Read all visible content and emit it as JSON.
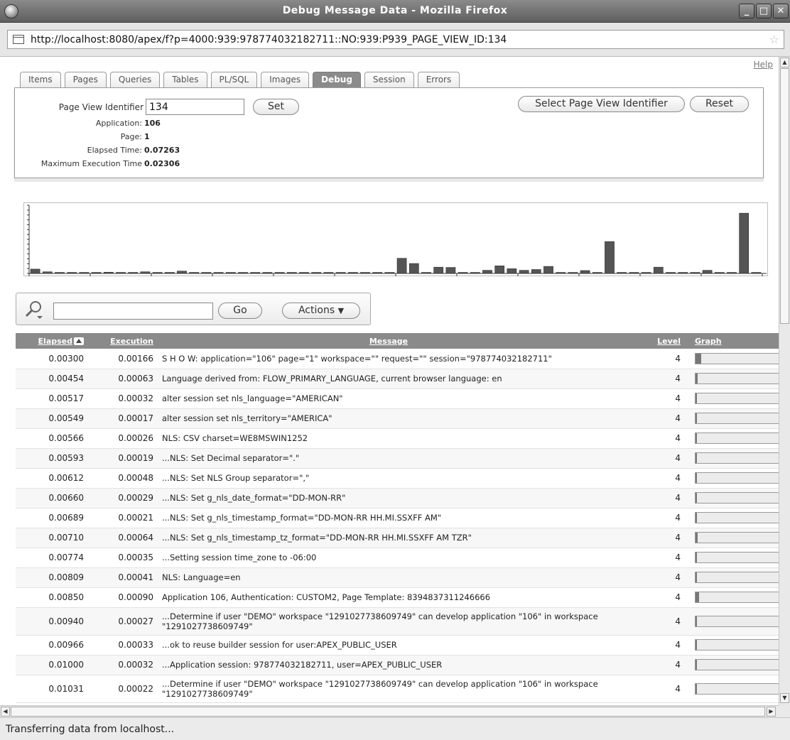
{
  "window": {
    "title": "Debug Message Data - Mozilla Firefox"
  },
  "browser": {
    "url": "http://localhost:8080/apex/f?p=4000:939:978774032182711::NO:939:P939_PAGE_VIEW_ID:134",
    "status": "Transferring data from localhost..."
  },
  "help_label": "Help",
  "tabs": [
    {
      "label": "Items"
    },
    {
      "label": "Pages"
    },
    {
      "label": "Queries"
    },
    {
      "label": "Tables"
    },
    {
      "label": "PL/SQL"
    },
    {
      "label": "Images"
    },
    {
      "label": "Debug"
    },
    {
      "label": "Session"
    },
    {
      "label": "Errors"
    }
  ],
  "active_tab": "Debug",
  "summary": {
    "page_view_label": "Page View Identifier",
    "page_view_value": "134",
    "set_label": "Set",
    "select_pv_label": "Select Page View Identifier",
    "reset_label": "Reset",
    "application_label": "Application:",
    "application_value": "106",
    "page_label": "Page:",
    "page_value": "1",
    "elapsed_label": "Elapsed Time:",
    "elapsed_value": "0.07263",
    "max_exec_label": "Maximum Execution Time",
    "max_exec_value": "0.02306"
  },
  "chart_data": {
    "type": "bar",
    "values": [
      0.00166,
      0.00063,
      0.00032,
      0.00017,
      0.00026,
      0.00019,
      0.00048,
      0.00029,
      0.00021,
      0.00064,
      0.00035,
      0.00041,
      0.0009,
      0.00027,
      0.00033,
      0.00032,
      0.00022,
      0.00018,
      0.00025,
      0.00031,
      0.00027,
      0.00023,
      0.00029,
      0.00019,
      0.00026,
      0.00024,
      0.00017,
      0.00022,
      0.00028,
      0.0003,
      0.0058,
      0.0038,
      0.00021,
      0.0024,
      0.0023,
      0.00019,
      0.00026,
      0.0012,
      0.0029,
      0.0018,
      0.0012,
      0.0015,
      0.0027,
      0.00028,
      0.00033,
      0.0011,
      0.00029,
      0.0122,
      0.00021,
      0.00019,
      0.00025,
      0.0024,
      0.00031,
      0.00022,
      0.00028,
      0.0012,
      0.00024,
      0.00021,
      0.02306,
      0.00031
    ],
    "ylim": [
      0,
      0.025
    ],
    "grid": false,
    "bar_color": "#555555"
  },
  "search": {
    "go_label": "Go",
    "actions_label": "Actions"
  },
  "report": {
    "headers": {
      "elapsed": "Elapsed",
      "execution": "Execution",
      "message": "Message",
      "level": "Level",
      "graph": "Graph"
    },
    "rows": [
      {
        "elapsed": "0.00300",
        "execution": "0.00166",
        "message": "S H O W: application=\"106\" page=\"1\" workspace=\"\" request=\"\" session=\"978774032182711\"",
        "level": "4",
        "graph": 0.072
      },
      {
        "elapsed": "0.00454",
        "execution": "0.00063",
        "message": "Language derived from: FLOW_PRIMARY_LANGUAGE, current browser language: en",
        "level": "4",
        "graph": 0.027
      },
      {
        "elapsed": "0.00517",
        "execution": "0.00032",
        "message": "alter session set nls_language=\"AMERICAN\"",
        "level": "4",
        "graph": 0.014
      },
      {
        "elapsed": "0.00549",
        "execution": "0.00017",
        "message": "alter session set nls_territory=\"AMERICA\"",
        "level": "4",
        "graph": 0.007
      },
      {
        "elapsed": "0.00566",
        "execution": "0.00026",
        "message": "NLS: CSV charset=WE8MSWIN1252",
        "level": "4",
        "graph": 0.011
      },
      {
        "elapsed": "0.00593",
        "execution": "0.00019",
        "message": "...NLS: Set Decimal separator=\".\"",
        "level": "4",
        "graph": 0.008
      },
      {
        "elapsed": "0.00612",
        "execution": "0.00048",
        "message": "...NLS: Set NLS Group separator=\",\"",
        "level": "4",
        "graph": 0.021
      },
      {
        "elapsed": "0.00660",
        "execution": "0.00029",
        "message": "...NLS: Set g_nls_date_format=\"DD-MON-RR\"",
        "level": "4",
        "graph": 0.013
      },
      {
        "elapsed": "0.00689",
        "execution": "0.00021",
        "message": "...NLS: Set g_nls_timestamp_format=\"DD-MON-RR HH.MI.SSXFF AM\"",
        "level": "4",
        "graph": 0.009
      },
      {
        "elapsed": "0.00710",
        "execution": "0.00064",
        "message": "...NLS: Set g_nls_timestamp_tz_format=\"DD-MON-RR HH.MI.SSXFF AM TZR\"",
        "level": "4",
        "graph": 0.028
      },
      {
        "elapsed": "0.00774",
        "execution": "0.00035",
        "message": "...Setting session time_zone to -06:00",
        "level": "4",
        "graph": 0.015
      },
      {
        "elapsed": "0.00809",
        "execution": "0.00041",
        "message": "NLS: Language=en",
        "level": "4",
        "graph": 0.018
      },
      {
        "elapsed": "0.00850",
        "execution": "0.00090",
        "message": "Application 106, Authentication: CUSTOM2, Page Template: 8394837311246666",
        "level": "4",
        "graph": 0.039
      },
      {
        "elapsed": "0.00940",
        "execution": "0.00027",
        "message": "...Determine if user \"DEMO\" workspace \"1291027738609749\" can develop application \"106\" in workspace \"1291027738609749\"",
        "level": "4",
        "graph": 0.012,
        "tall": true
      },
      {
        "elapsed": "0.00966",
        "execution": "0.00033",
        "message": "...ok to reuse builder session for user:APEX_PUBLIC_USER",
        "level": "4",
        "graph": 0.014
      },
      {
        "elapsed": "0.01000",
        "execution": "0.00032",
        "message": "...Application session: 978774032182711, user=APEX_PUBLIC_USER",
        "level": "4",
        "graph": 0.014
      },
      {
        "elapsed": "0.01031",
        "execution": "0.00022",
        "message": "...Determine if user \"DEMO\" workspace \"1291027738609749\" can develop application \"106\" in workspace \"1291027738609749\"",
        "level": "4",
        "graph": 0.01,
        "tall": true
      }
    ]
  }
}
